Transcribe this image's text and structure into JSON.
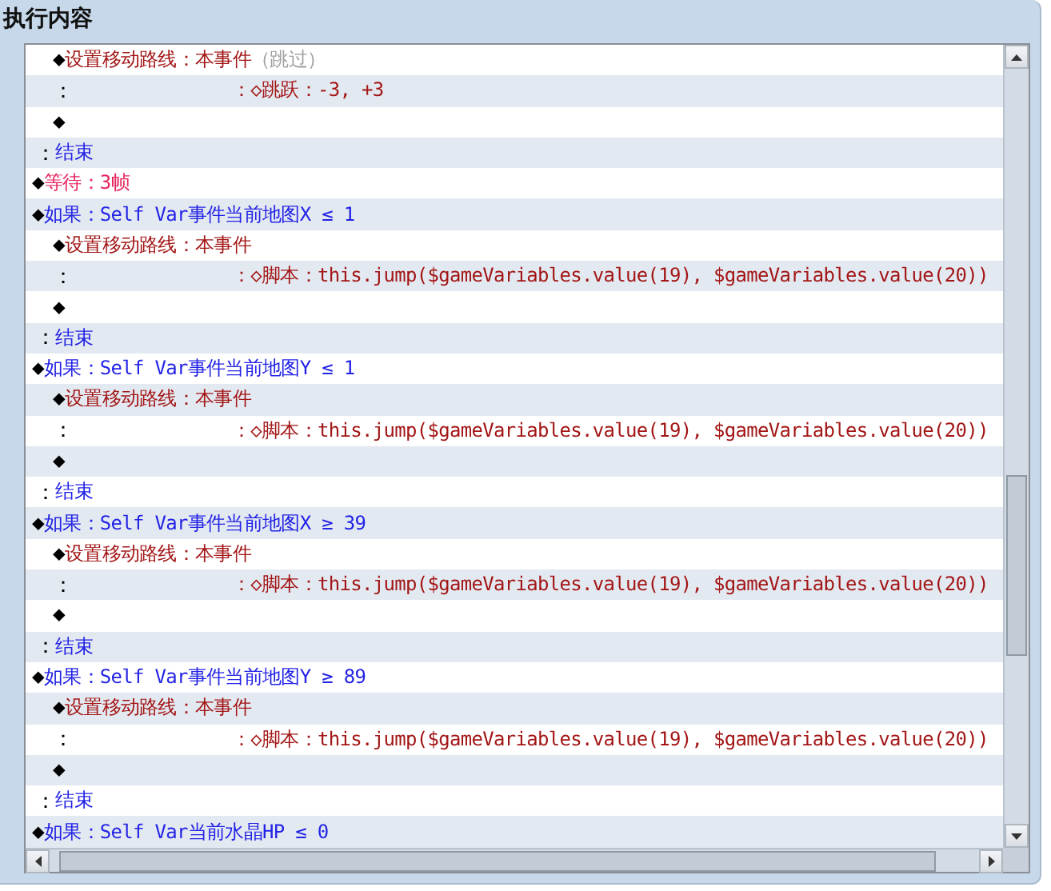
{
  "panel": {
    "title": "执行内容"
  },
  "commands": [
    {
      "children": [
        {
          "kind": "command",
          "marker": "◆",
          "segments": [
            {
              "text": "设置移动路线：本事件",
              "color": "#a31616"
            },
            {
              "text": "（跳过）",
              "color": "#a0a0a0"
            }
          ]
        },
        {
          "kind": "continuation",
          "marker": "：",
          "segments": [
            {
              "text": "：◇跳跃：-3, +3",
              "color": "#a31616"
            }
          ]
        },
        {
          "kind": "command",
          "marker": "◆"
        }
      ]
    },
    {
      "kind": "end",
      "marker": "：",
      "segments": [
        {
          "text": "结束",
          "color": "#2323e6"
        }
      ]
    },
    {
      "kind": "command",
      "marker": "◆",
      "segments": [
        {
          "text": "等待：3帧",
          "color": "#e8245c"
        }
      ]
    },
    {
      "kind": "command",
      "marker": "◆",
      "segments": [
        {
          "text": "如果：Self Var事件当前地图X ≤ 1",
          "color": "#2323e6"
        }
      ],
      "children": [
        {
          "kind": "command",
          "marker": "◆",
          "segments": [
            {
              "text": "设置移动路线：本事件",
              "color": "#a31616"
            }
          ]
        },
        {
          "kind": "continuation",
          "marker": "：",
          "segments": [
            {
              "text": "：◇脚本：this.jump($gameVariables.value(19), $gameVariables.value(20))",
              "color": "#a31616"
            }
          ]
        },
        {
          "kind": "command",
          "marker": "◆"
        }
      ]
    },
    {
      "kind": "end",
      "marker": "：",
      "segments": [
        {
          "text": "结束",
          "color": "#2323e6"
        }
      ]
    },
    {
      "kind": "command",
      "marker": "◆",
      "segments": [
        {
          "text": "如果：Self Var事件当前地图Y ≤ 1",
          "color": "#2323e6"
        }
      ],
      "children": [
        {
          "kind": "command",
          "marker": "◆",
          "segments": [
            {
              "text": "设置移动路线：本事件",
              "color": "#a31616"
            }
          ]
        },
        {
          "kind": "continuation",
          "marker": "：",
          "segments": [
            {
              "text": "：◇脚本：this.jump($gameVariables.value(19), $gameVariables.value(20))",
              "color": "#a31616"
            }
          ]
        },
        {
          "kind": "command",
          "marker": "◆"
        }
      ]
    },
    {
      "kind": "end",
      "marker": "：",
      "segments": [
        {
          "text": "结束",
          "color": "#2323e6"
        }
      ]
    },
    {
      "kind": "command",
      "marker": "◆",
      "segments": [
        {
          "text": "如果：Self Var事件当前地图X ≥ 39",
          "color": "#2323e6"
        }
      ],
      "children": [
        {
          "kind": "command",
          "marker": "◆",
          "segments": [
            {
              "text": "设置移动路线：本事件",
              "color": "#a31616"
            }
          ]
        },
        {
          "kind": "continuation",
          "marker": "：",
          "segments": [
            {
              "text": "：◇脚本：this.jump($gameVariables.value(19), $gameVariables.value(20))",
              "color": "#a31616"
            }
          ]
        },
        {
          "kind": "command",
          "marker": "◆"
        }
      ]
    },
    {
      "kind": "end",
      "marker": "：",
      "segments": [
        {
          "text": "结束",
          "color": "#2323e6"
        }
      ]
    },
    {
      "kind": "command",
      "marker": "◆",
      "segments": [
        {
          "text": "如果：Self Var事件当前地图Y ≥ 89",
          "color": "#2323e6"
        }
      ],
      "children": [
        {
          "kind": "command",
          "marker": "◆",
          "segments": [
            {
              "text": "设置移动路线：本事件",
              "color": "#a31616"
            }
          ]
        },
        {
          "kind": "continuation",
          "marker": "：",
          "segments": [
            {
              "text": "：◇脚本：this.jump($gameVariables.value(19), $gameVariables.value(20))",
              "color": "#a31616"
            }
          ]
        },
        {
          "kind": "command",
          "marker": "◆"
        }
      ]
    },
    {
      "kind": "end",
      "marker": "：",
      "segments": [
        {
          "text": "结束",
          "color": "#2323e6"
        }
      ]
    },
    {
      "kind": "command",
      "marker": "◆",
      "segments": [
        {
          "text": "如果：Self Var当前水晶HP ≤ 0",
          "color": "#2323e6"
        }
      ]
    }
  ]
}
